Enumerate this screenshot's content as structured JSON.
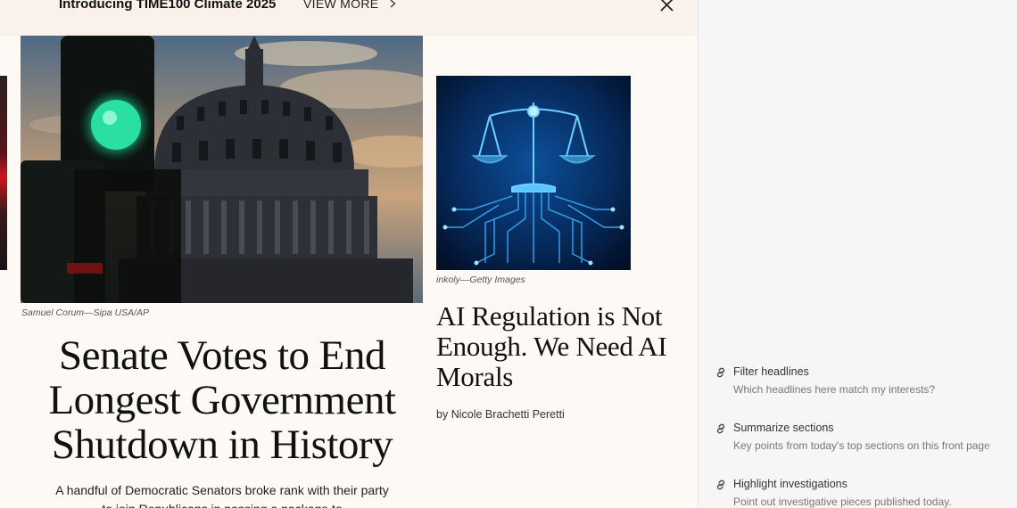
{
  "promo": {
    "title": "Introducing TIME100 Climate 2025",
    "link_label": "VIEW MORE"
  },
  "icons": {
    "close": "close-icon",
    "chevron": "chevron-right-icon",
    "suggestion": "link-icon"
  },
  "hero": {
    "caption": "Samuel Corum—Sipa USA/AP",
    "headline": "Senate Votes to End Longest Government Shutdown in History",
    "dek": "A handful of Democratic Senators broke rank with their party to join Republicans in passing a package to"
  },
  "side_story": {
    "caption": "inkoly—Getty Images",
    "headline": "AI Regulation is Not Enough. We Need AI Morals",
    "byline_prefix": "by",
    "author": "Nicole Brachetti Peretti"
  },
  "assistant": {
    "suggestions": [
      {
        "title": "Filter headlines",
        "description": "Which headlines here match my interests?"
      },
      {
        "title": "Summarize sections",
        "description": "Key points from today's top sections on this front page"
      },
      {
        "title": "Highlight investigations",
        "description": "Point out investigative pieces published today."
      }
    ]
  },
  "colors": {
    "article_bg": "#fdf9f5",
    "promo_bg": "#faf1ea",
    "panel_bg": "#f6f6f6",
    "headline": "#111111",
    "muted": "#777777"
  }
}
